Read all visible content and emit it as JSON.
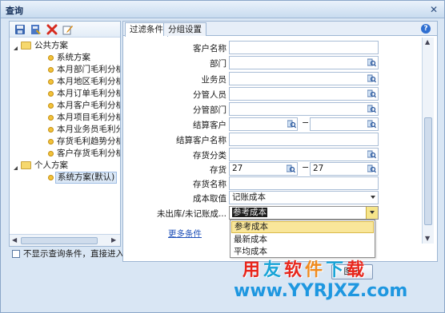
{
  "window": {
    "title": "查询",
    "close_glyph": "✕"
  },
  "toolbar": {
    "icons": [
      "save-icon",
      "save-as-icon",
      "delete-icon",
      "edit-icon"
    ]
  },
  "tree": {
    "public_group": "公共方案",
    "public_items": [
      "系统方案",
      "本月部门毛利分析",
      "本月地区毛利分析",
      "本月订单毛利分析",
      "本月客户毛利分析",
      "本月项目毛利分析",
      "本月业务员毛利分",
      "存货毛利趋势分析",
      "客户存货毛利分析"
    ],
    "personal_group": "个人方案",
    "personal_items": [
      "系统方案(默认)"
    ]
  },
  "skip_checkbox": {
    "label": "不显示查询条件，直接进入报表",
    "checked": false
  },
  "tabs": [
    "过滤条件",
    "分组设置"
  ],
  "active_tab": 0,
  "help_glyph": "?",
  "fields": {
    "customer_name": {
      "label": "客户名称",
      "value": ""
    },
    "department": {
      "label": "部门",
      "value": ""
    },
    "salesperson": {
      "label": "业务员",
      "value": ""
    },
    "manager": {
      "label": "分管人员",
      "value": ""
    },
    "manage_dept": {
      "label": "分管部门",
      "value": ""
    },
    "settle_customer": {
      "label": "结算客户",
      "value_from": "",
      "value_to": "",
      "separator": "−"
    },
    "settle_customer_name": {
      "label": "结算客户名称",
      "value": ""
    },
    "inventory_class": {
      "label": "存货分类",
      "value": ""
    },
    "inventory": {
      "label": "存货",
      "value_from": "27",
      "value_to": "27",
      "separator": "−"
    },
    "inventory_name": {
      "label": "存货名称",
      "value": ""
    },
    "cost_source": {
      "label": "成本取值",
      "value": "记账成本"
    },
    "unposted_cost": {
      "label": "未出库/未记账成...",
      "value": "参考成本"
    }
  },
  "more_conditions": "更多条件",
  "dropdown_options": [
    "参考成本",
    "最新成本",
    "平均成本"
  ],
  "dropdown_highlighted": 0,
  "ok_button": "图表",
  "watermark": {
    "line1": [
      "用",
      "友",
      "软",
      "件",
      "下",
      "载"
    ],
    "line2": "www.YYRJXZ.com"
  }
}
